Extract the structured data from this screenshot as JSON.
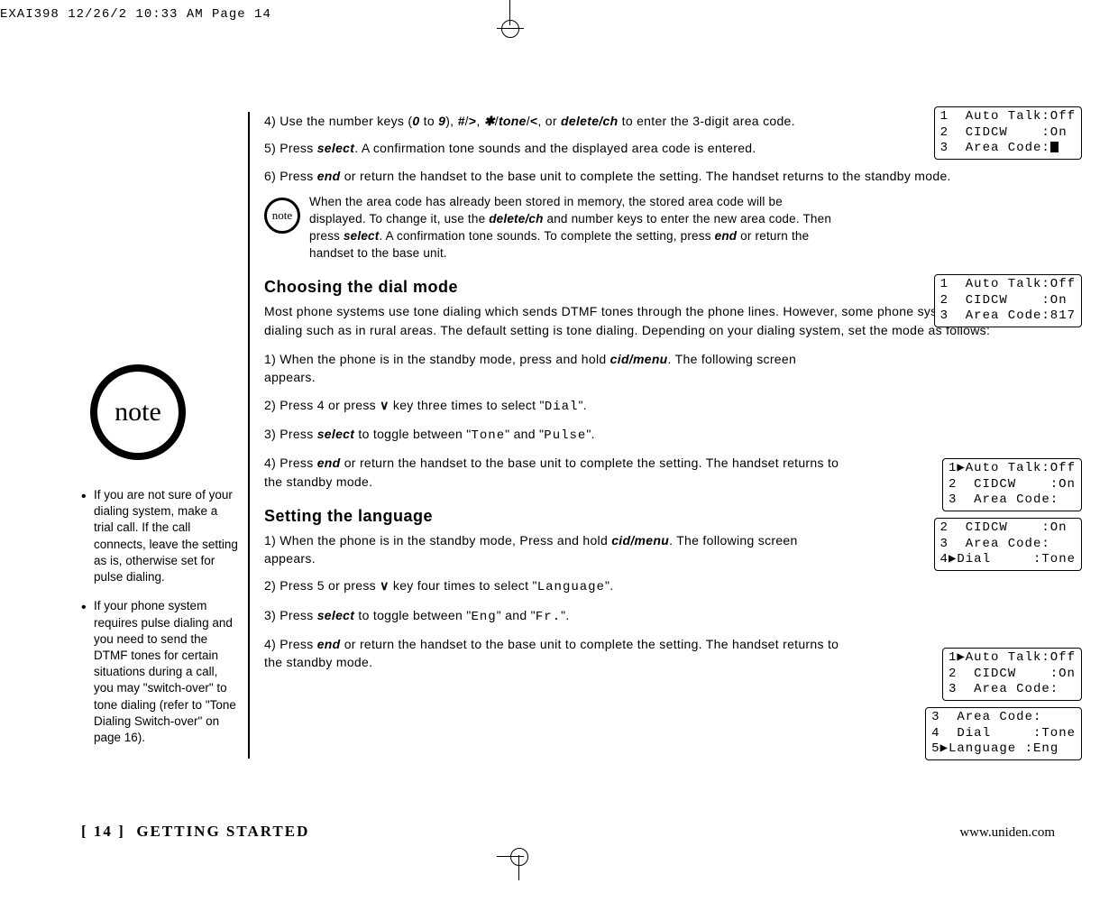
{
  "header": {
    "imprint": "EXAI398  12/26/2  10:33 AM  Page 14"
  },
  "sidebar": {
    "note_label": "note",
    "bullets": [
      "If you are not sure of your dialing system, make a trial call. If the call connects, leave the setting as is, otherwise set for pulse dialing.",
      "If your phone system requires pulse dialing and you need to send the DTMF tones for certain situations during a call, you may \"switch-over\" to tone dialing (refer to \"Tone Dialing Switch-over\" on page 16)."
    ]
  },
  "sections": {
    "area_code": {
      "step4_a": "4) Use the number keys (",
      "step4_zero": "0",
      "step4_to": " to ",
      "step4_nine": "9",
      "step4_b": "), ",
      "step4_hash": "#",
      "step4_slash1": "/",
      "step4_gt": ">",
      "step4_comma1": ", ",
      "step4_star": "✱",
      "step4_slash2": "/",
      "step4_tone": "tone",
      "step4_slash3": "/",
      "step4_lt": "<",
      "step4_comma2": ", or ",
      "step4_del": "delete/ch",
      "step4_c": " to enter the 3-digit area code.",
      "step5_a": "5) Press ",
      "step5_sel": "select",
      "step5_b": ". A confirmation tone sounds and the displayed area code is entered.",
      "step6_a": "6) Press ",
      "step6_end": "end",
      "step6_b": " or return the handset to the base unit to complete the setting. The handset returns to the standby mode.",
      "note_a": "When the area code has already been stored in memory, the stored area code will be displayed. To change it, use the ",
      "note_del": "delete/ch",
      "note_b": " and number keys to enter the new area code. Then press ",
      "note_sel": "select",
      "note_c": ". A confirmation tone sounds. To complete the setting, press ",
      "note_end": "end",
      "note_d": " or return the handset to the base unit."
    },
    "dial_mode": {
      "heading": "Choosing the dial mode",
      "intro": "Most phone systems use tone dialing which sends DTMF tones through the phone lines. However, some phone systems still use pulse dialing such as in rural areas. The default setting is tone dialing. Depending on your dialing system, set the mode as follows:",
      "step1_a": "1) When the phone is in the standby mode, press and hold ",
      "step1_cid": "cid/menu",
      "step1_b": ". The following screen appears.",
      "step2_a": "2) Press 4 or press ",
      "step2_v": "∨",
      "step2_b": " key three times to select \"",
      "step2_dial": "Dial",
      "step2_c": "\".",
      "step3_a": "3) Press ",
      "step3_sel": "select",
      "step3_b": " to toggle between \"",
      "step3_tone": "Tone",
      "step3_c": "\" and \"",
      "step3_pulse": "Pulse",
      "step3_d": "\".",
      "step4_a": "4) Press ",
      "step4_end": "end",
      "step4_b": " or return the handset to the base unit to complete the setting. The handset returns to the standby mode."
    },
    "language": {
      "heading": "Setting the language",
      "step1_a": "1) When the phone is in the standby mode, Press and hold ",
      "step1_cid": "cid/menu",
      "step1_b": ". The following screen appears.",
      "step2_a": "2) Press 5 or press ",
      "step2_v": "∨",
      "step2_b": " key four times to select \"",
      "step2_lang": "Language",
      "step2_c": "\".",
      "step3_a": "3) Press ",
      "step3_sel": "select",
      "step3_b": " to toggle between \"",
      "step3_eng": "Eng",
      "step3_c": "\" and \"",
      "step3_fr": "Fr.",
      "step3_d": "\".",
      "step4_a": "4) Press ",
      "step4_end": "end",
      "step4_b": " or return the handset to the base unit to complete the setting. The handset returns to the standby mode."
    }
  },
  "lcd": {
    "screen1": "1  Auto Talk:Off\n2  CIDCW    :On\n3  Area Code:",
    "screen2": "1  Auto Talk:Off\n2  CIDCW    :On\n3  Area Code:817",
    "screen3": "1▶Auto Talk:Off\n2  CIDCW    :On\n3  Area Code:",
    "screen4": "2  CIDCW    :On\n3  Area Code:\n4▶Dial     :Tone",
    "screen5": "1▶Auto Talk:Off\n2  CIDCW    :On\n3  Area Code:",
    "screen6": "3  Area Code:\n4  Dial     :Tone\n5▶Language :Eng"
  },
  "footer": {
    "page_num": "[ 14 ]",
    "section": "GETTING STARTED",
    "url": "www.uniden.com"
  },
  "icons": {
    "note_small": "note"
  }
}
